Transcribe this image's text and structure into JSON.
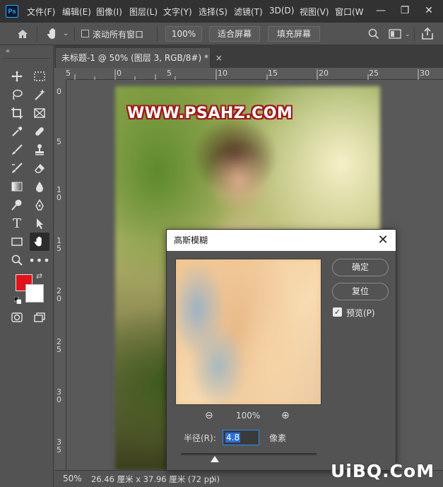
{
  "app": {
    "logo_text": "Ps"
  },
  "menu": {
    "items": [
      "文件(F)",
      "编辑(E)",
      "图像(I)",
      "图层(L)",
      "文字(Y)",
      "选择(S)",
      "滤镜(T)",
      "3D(D)",
      "视图(V)",
      "窗口(W"
    ]
  },
  "window_controls": {
    "minimize": "—",
    "restore": "❐",
    "close": "✕"
  },
  "options": {
    "scroll_all_label": "滚动所有窗口",
    "scroll_all_checked": false,
    "zoom_value": "100%",
    "fit_screen_label": "适合屏幕",
    "fill_screen_label": "填充屏幕"
  },
  "document": {
    "tab_title": "未标题-1 @ 50% (图层 3, RGB/8#) *",
    "tab_close": "×"
  },
  "ruler_top": [
    "5",
    "0",
    "5",
    "10",
    "15",
    "20",
    "25",
    "30"
  ],
  "ruler_left": [
    "0",
    "5",
    "1\n0",
    "1\n5",
    "2\n0",
    "2\n5",
    "3\n0",
    "3\n5"
  ],
  "canvas": {
    "watermark_text": "WWW.PSAHZ.COM"
  },
  "colors": {
    "foreground": "#e0141c",
    "background": "#ffffff",
    "accent": "#2a8cff"
  },
  "status": {
    "zoom": "50%",
    "doc_info": "26.46 厘米 x 37.96 厘米 (72 ppi)",
    "arrow": "〉"
  },
  "dialog": {
    "title": "高斯模糊",
    "close": "✕",
    "ok_label": "确定",
    "reset_label": "复位",
    "preview_label": "预览(P)",
    "preview_checked": true,
    "zoom_out_icon": "⊖",
    "zoom_level": "100%",
    "zoom_in_icon": "⊕",
    "radius_label": "半径(R):",
    "radius_value": "4.8",
    "radius_unit": "像素",
    "radius_fraction": 0.25
  },
  "site_mark": "UiBQ.CoM"
}
